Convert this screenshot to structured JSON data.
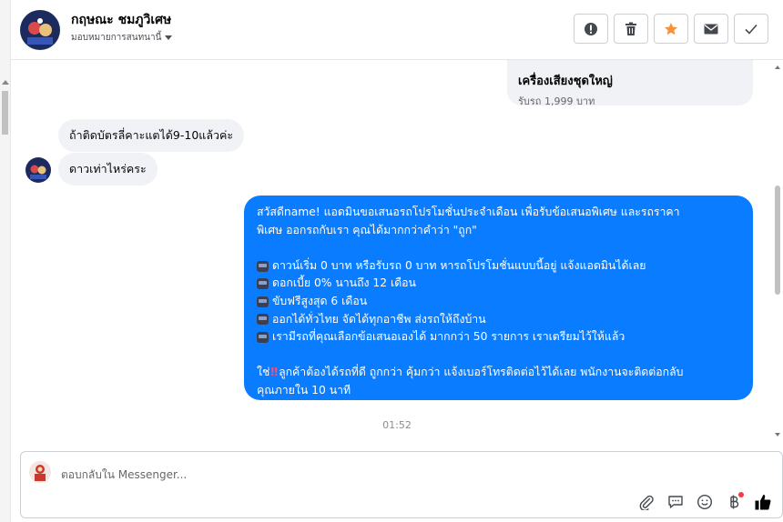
{
  "header": {
    "contact_name": "กฤษณะ ชมภูวิเศษ",
    "assign_label": "มอบหมายการสนทนานี้",
    "buttons": [
      "alert",
      "delete",
      "star",
      "mail",
      "done"
    ]
  },
  "product_card": {
    "title": "เครื่องเสียงชุดใหญ่",
    "subtitle": "รับรถ 1,999 บาท"
  },
  "messages": {
    "incoming": [
      "ถ้าติดบัตรลี่คาะแตได้9-10แล้วค่ะ",
      "ดาวเท่าไหร่คระ"
    ],
    "outgoing": {
      "intro_1": "สวัสดีname! แอดมินขอเสนอรถโปรโมชั่นประจำเดือน เพื่อรับข้อเสนอพิเศษ และรถราคา",
      "intro_2": "พิเศษ ออกรถกับเรา คุณได้มากกว่าคำว่า \"ถูก\"",
      "bullets": [
        "ดาวน์เริ่ม 0 บาท หรือรับรถ 0 บาท หารถโปรโมชั่นแบบนี้อยู่ แจ้งแอดมินได้เลย",
        "ดอกเบี้ย 0% นานถึง 12 เดือน",
        "ขับฟรีสูงสุด 6 เดือน",
        "ออกได้ทั่วไทย จัดได้ทุกอาชีพ ส่งรถให้ถึงบ้าน",
        "เรามีรถที่คุณเลือกข้อเสนอเองได้ มากกว่า 50 รายการ เราเตรียมไว้ให้แล้ว"
      ],
      "closing_prefix": "ใช่",
      "closing_mark": "‼",
      "closing_1": "ลูกค้าต้องได้รถที่ดี ถูกกว่า คุ้มกว่า แจ้งเบอร์โทรติดต่อไว้ได้เลย พนักงานจะติดต่อกลับ",
      "closing_2": "คุณภายใน 10 นาที"
    },
    "timestamp": "01:52"
  },
  "composer": {
    "placeholder": "ตอบกลับใน Messenger..."
  },
  "colors": {
    "accent": "#0a7cff",
    "star": "#f7923a",
    "incoming_bg": "#f0f2f5",
    "badge": "#fa383e"
  }
}
